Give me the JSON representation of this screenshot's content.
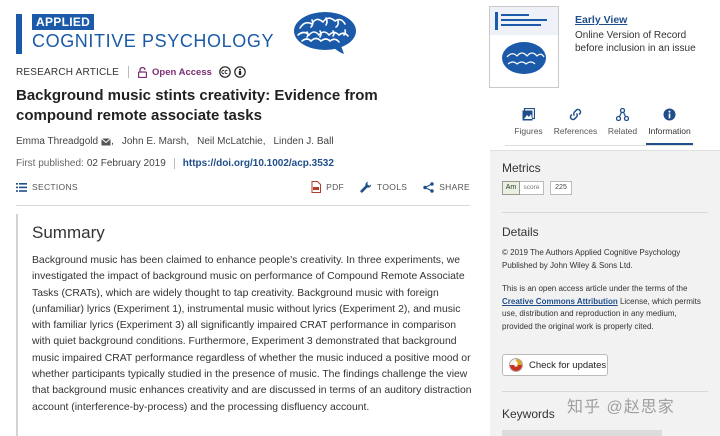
{
  "journal": {
    "logo_top": "APPLIED",
    "logo_main": "COGNITIVE PSYCHOLOGY",
    "brand_color": "#1a5aa8",
    "brain_icon": "brain-logo-icon"
  },
  "article": {
    "type": "RESEARCH ARTICLE",
    "open_access": "Open Access",
    "title": "Background music stints creativity: Evidence from compound remote associate tasks",
    "authors": [
      "Emma Threadgold",
      "John E. Marsh,",
      "Neil McLatchie,",
      "Linden J. Ball"
    ],
    "first_published_label": "First published:",
    "first_published_date": "02 February 2019",
    "doi": "https://doi.org/10.1002/acp.3532"
  },
  "toolbar": {
    "sections": "SECTIONS",
    "pdf": "PDF",
    "tools": "TOOLS",
    "share": "SHARE"
  },
  "summary": {
    "heading": "Summary",
    "text": "Background music has been claimed to enhance people's creativity. In three experiments, we investigated the impact of background music on performance of Compound Remote Associate Tasks (CRATs), which are widely thought to tap creativity. Background music with foreign (unfamiliar) lyrics (Experiment 1), instrumental music without lyrics (Experiment 2), and music with familiar lyrics (Experiment 3) all significantly impaired CRAT performance in comparison with quiet background conditions. Furthermore, Experiment 3 demonstrated that background music impaired CRAT performance regardless of whether the music induced a positive mood or whether participants typically studied in the presence of music. The findings challenge the view that background music enhances creativity and are discussed in terms of an auditory distraction account (interference-by-process) and the processing disfluency account."
  },
  "early_view": {
    "link": "Early View",
    "description": "Online Version of Record before inclusion in an issue"
  },
  "tabs": [
    {
      "label": "Figures",
      "icon": "figures-icon"
    },
    {
      "label": "References",
      "icon": "link-icon"
    },
    {
      "label": "Related",
      "icon": "related-icon"
    },
    {
      "label": "Information",
      "icon": "info-icon",
      "active": true
    }
  ],
  "metrics": {
    "title": "Metrics",
    "altmetric_badge": "Am",
    "altmetric_label": "score",
    "altmetric_score": "225"
  },
  "details": {
    "title": "Details",
    "copyright": "© 2019 The Authors Applied Cognitive Psychology Published by John Wiley & Sons Ltd.",
    "license_before": "This is an open access article under the terms of the ",
    "license_link": "Creative Commons Attribution",
    "license_after": " License, which permits use, distribution and reproduction in any medium, provided the original work is properly cited.",
    "check_updates": "Check for updates"
  },
  "keywords": {
    "title": "Keywords"
  },
  "watermark": "知乎 @赵思家"
}
